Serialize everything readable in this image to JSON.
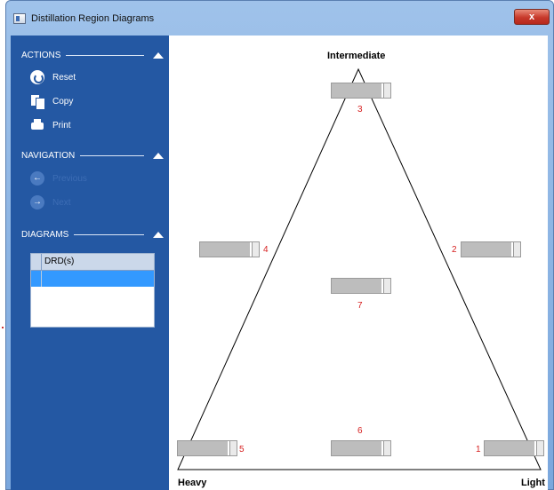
{
  "window": {
    "title": "Distillation Region Diagrams",
    "close_label": "x"
  },
  "sidebar": {
    "actions": {
      "title": "ACTIONS",
      "items": [
        {
          "label": "Reset",
          "icon": "reset-icon"
        },
        {
          "label": "Copy",
          "icon": "copy-icon"
        },
        {
          "label": "Print",
          "icon": "print-icon"
        }
      ]
    },
    "navigation": {
      "title": "NAVIGATION",
      "items": [
        {
          "label": "Previous",
          "icon": "arrow-left-icon",
          "enabled": false
        },
        {
          "label": "Next",
          "icon": "arrow-right-icon",
          "enabled": false
        }
      ]
    },
    "diagrams": {
      "title": "DIAGRAMS",
      "grid": {
        "column": "DRD(s)"
      }
    }
  },
  "diagram": {
    "vertices": {
      "top": "Intermediate",
      "bottom_left": "Heavy",
      "bottom_right": "Light"
    },
    "regions": [
      {
        "number": "1",
        "value": 0.85
      },
      {
        "number": "2",
        "value": 0.85
      },
      {
        "number": "3",
        "value": 0.85
      },
      {
        "number": "4",
        "value": 0.85
      },
      {
        "number": "5",
        "value": 0.85
      },
      {
        "number": "6",
        "value": 0.85
      },
      {
        "number": "7",
        "value": 0.85
      }
    ]
  },
  "colors": {
    "sidebar": "#2458a3",
    "region_number": "#d61f1f",
    "selected_row": "#3399ff"
  }
}
